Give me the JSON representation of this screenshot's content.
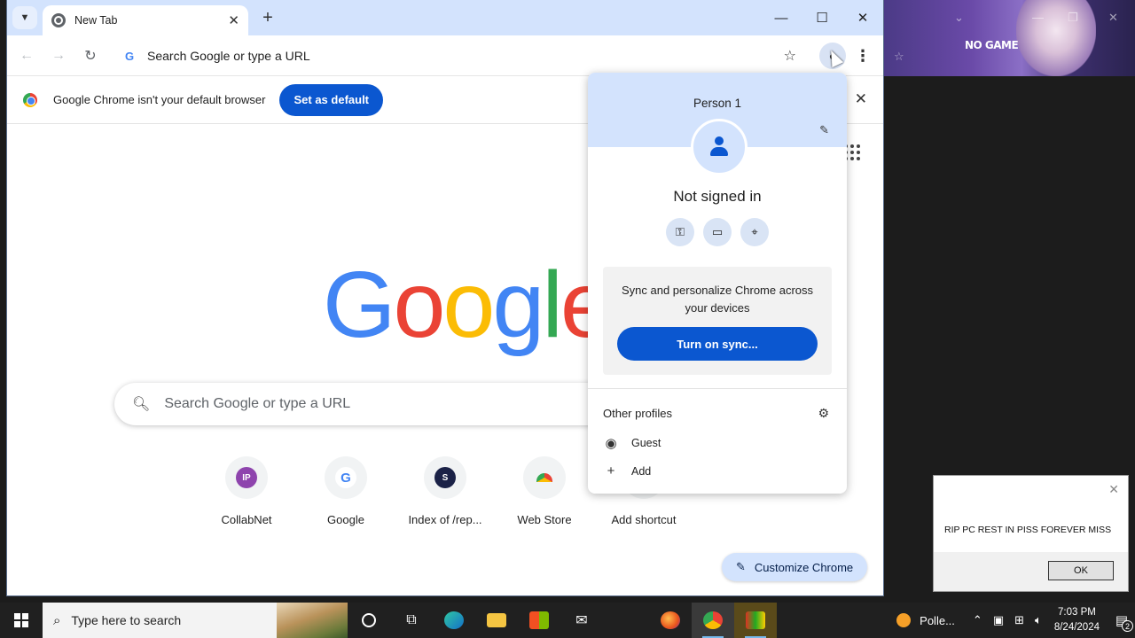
{
  "browser": {
    "tab_title": "New Tab",
    "omnibox_placeholder": "Search Google or type a URL",
    "infobar_message": "Google Chrome isn't your default browser",
    "set_default_label": "Set as default"
  },
  "ntp": {
    "logo_text": [
      "G",
      "o",
      "o",
      "g",
      "l",
      "e"
    ],
    "search_placeholder": "Search Google or type a URL",
    "shortcuts": [
      {
        "label": "CollabNet",
        "badge": "IP",
        "color": "#8e44ad"
      },
      {
        "label": "Google",
        "badge": "G",
        "color": "#ffffff"
      },
      {
        "label": "Index of /rep...",
        "badge": "S",
        "color": "#1b2247"
      },
      {
        "label": "Web Store",
        "badge": "",
        "color": "#e94235"
      },
      {
        "label": "Add shortcut",
        "badge": "+",
        "color": "#ffffff"
      }
    ],
    "customize_label": "Customize Chrome"
  },
  "profile_menu": {
    "name": "Person 1",
    "status": "Not signed in",
    "sync_message": "Sync and personalize Chrome across your devices",
    "sync_button": "Turn on sync...",
    "other_profiles_label": "Other profiles",
    "guest_label": "Guest",
    "add_label": "Add"
  },
  "dialog": {
    "message": "RIP PC REST IN PISS FOREVER MISS",
    "ok_label": "OK"
  },
  "wallpaper": {
    "logo_text": "NO GAME"
  },
  "taskbar": {
    "search_placeholder": "Type here to search",
    "weather_label": "Polle...",
    "time": "7:03 PM",
    "date": "8/24/2024",
    "notification_count": "2"
  }
}
